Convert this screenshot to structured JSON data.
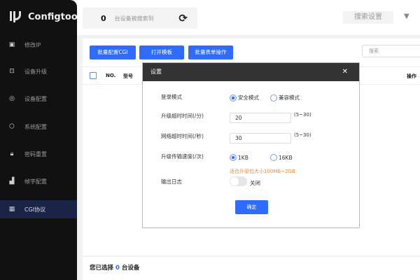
{
  "app": {
    "title": "Configtool"
  },
  "sidebar": {
    "items": [
      {
        "label": "修改IP",
        "icon": "ip-icon"
      },
      {
        "label": "设备升级",
        "icon": "upload-icon"
      },
      {
        "label": "设备配置",
        "icon": "target-icon"
      },
      {
        "label": "系统配置",
        "icon": "gear-icon"
      },
      {
        "label": "密码重置",
        "icon": "lock-icon"
      },
      {
        "label": "帧字配置",
        "icon": "bar-chart-icon"
      },
      {
        "label": "CGI协议",
        "icon": "qr-icon",
        "active": true
      }
    ]
  },
  "topbar": {
    "count": "0",
    "count_label": "台设备被搜索到",
    "search_settings": "搜索设置"
  },
  "toolbar": {
    "batch_cgi": "批量配置CGI",
    "open_template": "打开模板",
    "batch_form": "批量表单操作",
    "search_placeholder": "搜索"
  },
  "table": {
    "columns": [
      "NO.",
      "型号",
      "操作"
    ]
  },
  "footer": {
    "prefix": "您已选择",
    "count": "0",
    "suffix": "台设备"
  },
  "modal": {
    "title": "设置",
    "login_mode": {
      "label": "登录模式",
      "options": [
        "安全模式",
        "兼容模式"
      ],
      "selected": "安全模式"
    },
    "upgrade_timeout": {
      "label": "升级超时时间(/分)",
      "value": "20",
      "range": "(5~30)"
    },
    "network_timeout": {
      "label": "网络超时时间(/秒)",
      "value": "30",
      "range": "(5~30)"
    },
    "transfer_speed": {
      "label": "升级传输速度(/次)",
      "options": [
        "1KB",
        "16KB"
      ],
      "selected": "1KB",
      "hint": "适合升级包大小100MB~2GB"
    },
    "log_output": {
      "label": "输出日志",
      "state": "关闭",
      "on": false
    },
    "confirm": "确定"
  },
  "colors": {
    "accent": "#2f6bff",
    "sidebar": "#111111",
    "hint": "#f08a3c"
  }
}
